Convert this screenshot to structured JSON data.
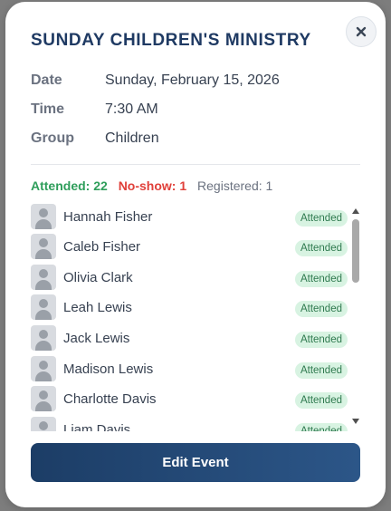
{
  "event": {
    "title": "SUNDAY CHILDREN'S MINISTRY",
    "details": [
      {
        "label": "Date",
        "value": "Sunday, February 15, 2026"
      },
      {
        "label": "Time",
        "value": "7:30 AM"
      },
      {
        "label": "Group",
        "value": "Children"
      }
    ]
  },
  "stats": {
    "attended": "Attended: 22",
    "no_show": "No-show: 1",
    "registered": "Registered: 1"
  },
  "attendees": [
    {
      "name": "Hannah Fisher",
      "status": "Attended"
    },
    {
      "name": "Caleb Fisher",
      "status": "Attended"
    },
    {
      "name": "Olivia Clark",
      "status": "Attended"
    },
    {
      "name": "Leah Lewis",
      "status": "Attended"
    },
    {
      "name": "Jack Lewis",
      "status": "Attended"
    },
    {
      "name": "Madison Lewis",
      "status": "Attended"
    },
    {
      "name": "Charlotte Davis",
      "status": "Attended"
    },
    {
      "name": "Liam Davis",
      "status": "Attended"
    }
  ],
  "actions": {
    "edit_label": "Edit Event",
    "close_icon": "close-icon"
  },
  "colors": {
    "title": "#1f3a63",
    "attended": "#2f9e5b",
    "no_show": "#e0403a",
    "badge_bg": "#d8f3e2",
    "button": "#1c3d66"
  }
}
